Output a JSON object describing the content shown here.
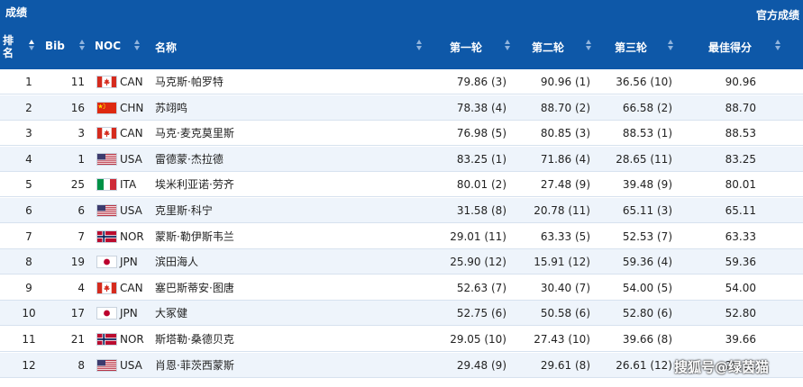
{
  "header": {
    "title": "成绩",
    "official_results_link": "官方成绩",
    "columns": {
      "rank": "排\n名",
      "bib": "Bib",
      "noc": "NOC",
      "name": "名称",
      "round1": "第一轮",
      "round2": "第二轮",
      "round3": "第三轮",
      "best": "最佳得分"
    }
  },
  "rows": [
    {
      "rank": "1",
      "bib": "11",
      "noc": "CAN",
      "name": "马克斯·帕罗特",
      "r1": "79.86 (3)",
      "r2": "90.96 (1)",
      "r3": "36.56 (10)",
      "best": "90.96",
      "flag": "can-flag-icon"
    },
    {
      "rank": "2",
      "bib": "16",
      "noc": "CHN",
      "name": "苏翊鸣",
      "r1": "78.38 (4)",
      "r2": "88.70 (2)",
      "r3": "66.58 (2)",
      "best": "88.70",
      "flag": "chn-flag-icon"
    },
    {
      "rank": "3",
      "bib": "3",
      "noc": "CAN",
      "name": "马克·麦克莫里斯",
      "r1": "76.98 (5)",
      "r2": "80.85 (3)",
      "r3": "88.53 (1)",
      "best": "88.53",
      "flag": "can-flag-icon"
    },
    {
      "rank": "4",
      "bib": "1",
      "noc": "USA",
      "name": "雷德蒙·杰拉德",
      "r1": "83.25 (1)",
      "r2": "71.86 (4)",
      "r3": "28.65 (11)",
      "best": "83.25",
      "flag": "usa-flag-icon"
    },
    {
      "rank": "5",
      "bib": "25",
      "noc": "ITA",
      "name": "埃米利亚诺·劳齐",
      "r1": "80.01 (2)",
      "r2": "27.48 (9)",
      "r3": "39.48 (9)",
      "best": "80.01",
      "flag": "ita-flag-icon"
    },
    {
      "rank": "6",
      "bib": "6",
      "noc": "USA",
      "name": "克里斯·科宁",
      "r1": "31.58 (8)",
      "r2": "20.78 (11)",
      "r3": "65.11 (3)",
      "best": "65.11",
      "flag": "usa-flag-icon"
    },
    {
      "rank": "7",
      "bib": "7",
      "noc": "NOR",
      "name": "蒙斯·勒伊斯韦兰",
      "r1": "29.01 (11)",
      "r2": "63.33 (5)",
      "r3": "52.53 (7)",
      "best": "63.33",
      "flag": "nor-flag-icon"
    },
    {
      "rank": "8",
      "bib": "19",
      "noc": "JPN",
      "name": "滨田海人",
      "r1": "25.90 (12)",
      "r2": "15.91 (12)",
      "r3": "59.36 (4)",
      "best": "59.36",
      "flag": "jpn-flag-icon"
    },
    {
      "rank": "9",
      "bib": "4",
      "noc": "CAN",
      "name": "塞巴斯蒂安·图唐",
      "r1": "52.63 (7)",
      "r2": "30.40 (7)",
      "r3": "54.00 (5)",
      "best": "54.00",
      "flag": "can-flag-icon"
    },
    {
      "rank": "10",
      "bib": "17",
      "noc": "JPN",
      "name": "大冢健",
      "r1": "52.75 (6)",
      "r2": "50.58 (6)",
      "r3": "52.80 (6)",
      "best": "52.80",
      "flag": "jpn-flag-icon"
    },
    {
      "rank": "11",
      "bib": "21",
      "noc": "NOR",
      "name": "斯塔勒·桑德贝克",
      "r1": "29.05 (10)",
      "r2": "27.43 (10)",
      "r3": "39.66 (8)",
      "best": "39.66",
      "flag": "nor-flag-icon"
    },
    {
      "rank": "12",
      "bib": "8",
      "noc": "USA",
      "name": "肖恩·菲茨西蒙斯",
      "r1": "29.48 (9)",
      "r2": "29.61 (8)",
      "r3": "26.61 (12)",
      "best": "29.61",
      "flag": "usa-flag-icon"
    }
  ],
  "watermark": "搜狐号@绿茵猫",
  "colors": {
    "header_bg": "#0e58a8",
    "row_alt_bg": "#eef4fb",
    "text": "#222222"
  }
}
